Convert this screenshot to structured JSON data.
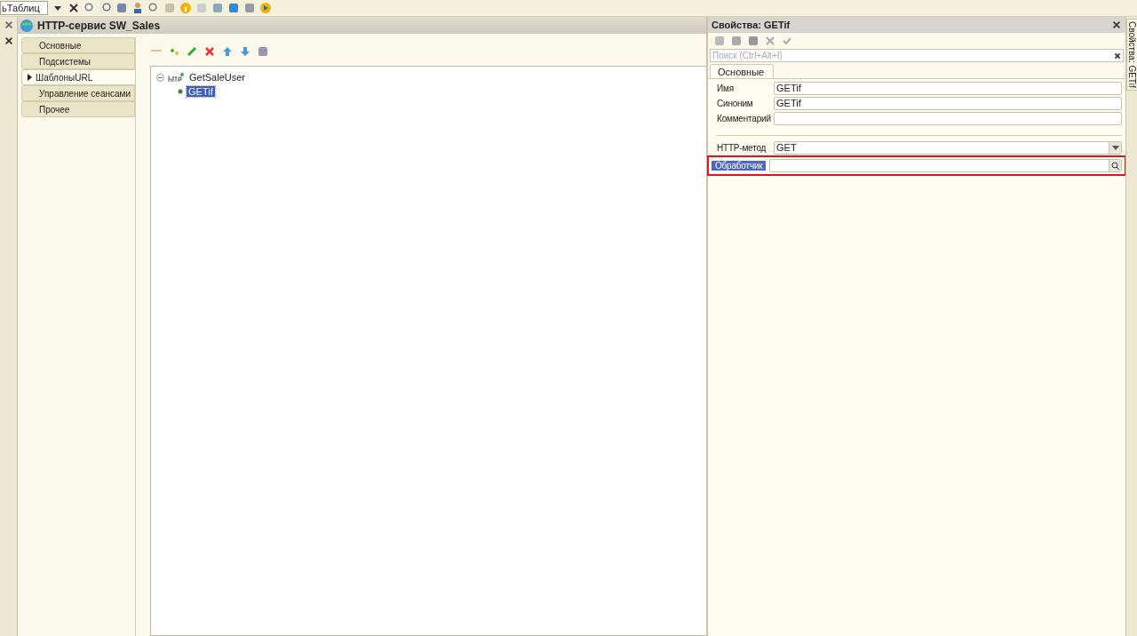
{
  "toolbar": {
    "combo_value": "ьТаблиц"
  },
  "window": {
    "title": "HTTP-сервис SW_Sales",
    "nav": [
      {
        "label": "Основные",
        "selected": false
      },
      {
        "label": "Подсистемы",
        "selected": false
      },
      {
        "label": "ШаблоныURL",
        "selected": true
      },
      {
        "label": "Управление сеансами",
        "selected": false
      },
      {
        "label": "Прочее",
        "selected": false
      }
    ],
    "tree": [
      {
        "label": "GetSaleUser",
        "expanded": true,
        "children": [
          {
            "label": "GETif",
            "selected": true
          }
        ]
      }
    ]
  },
  "properties": {
    "title": "Свойства: GETif",
    "search": {
      "placeholder": "Поиск (Ctrl+Alt+I)"
    },
    "tabs": [
      {
        "label": "Основные",
        "selected": true
      }
    ],
    "fields": [
      {
        "label": "Имя",
        "value": "GETif"
      },
      {
        "label": "Синоним",
        "value": "GETif"
      },
      {
        "label": "Комментарий"
      }
    ],
    "http_method": {
      "label": "HTTP-метод",
      "value": "GET"
    },
    "handler": {
      "label": "Обработчик",
      "selected": true,
      "highlighted": true
    }
  },
  "side_tab": {
    "label": "Свойства: GETif"
  }
}
